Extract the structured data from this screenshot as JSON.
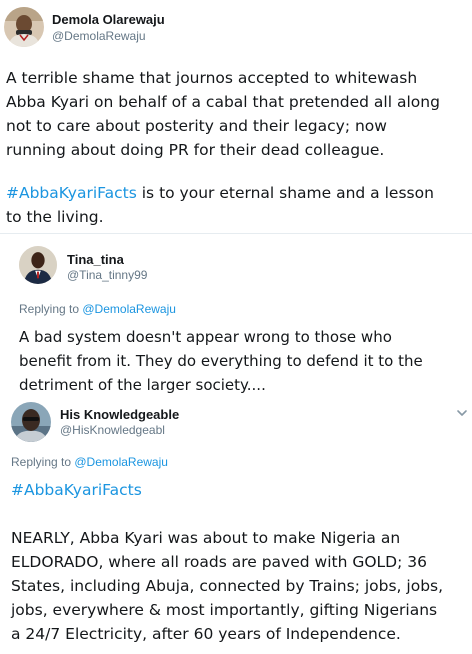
{
  "main_tweet": {
    "display_name": "Demola Olarewaju",
    "handle": "@DemolaRewaju",
    "paragraph1": [
      "A terrible shame that journos accepted to whitewash",
      "Abba Kyari on behalf of a cabal that pretended all along",
      "not to care about posterity and their legacy; now",
      "running about doing PR for their dead colleague."
    ],
    "hashtag": "#AbbaKyariFacts",
    "paragraph2_rest": " is to your eternal shame and a lesson",
    "paragraph2_line2": "to the living.",
    "chevron_icon": "chevron-down-icon"
  },
  "reply1": {
    "display_name": "Tina_tina",
    "handle": "@Tina_tinny99",
    "replying_prefix": "Replying to ",
    "replying_to": "@DemolaRewaju",
    "text_lines": [
      "A bad system doesn't appear wrong to those who",
      "benefit from it. They do everything to defend it to the",
      "detriment of the larger society...."
    ]
  },
  "reply2": {
    "display_name": "His Knowledgeable",
    "handle": "@HisKnowledgeabl",
    "replying_prefix": "Replying to ",
    "replying_to": "@DemolaRewaju",
    "hashtag": "#AbbaKyariFacts",
    "text_lines": [
      "NEARLY, Abba Kyari was about to make Nigeria an",
      "ELDORADO, where all roads are paved with GOLD; 36",
      "States, including Abuja, connected by Trains; jobs, jobs,",
      "jobs, everywhere & most importantly, gifting Nigerians",
      "a 24/7 Electricity, after 60 years of Independence."
    ],
    "chevron_icon": "chevron-down-icon"
  },
  "colors": {
    "link": "#1b95e0",
    "secondary_text": "#657786",
    "primary_text": "#14171a"
  }
}
